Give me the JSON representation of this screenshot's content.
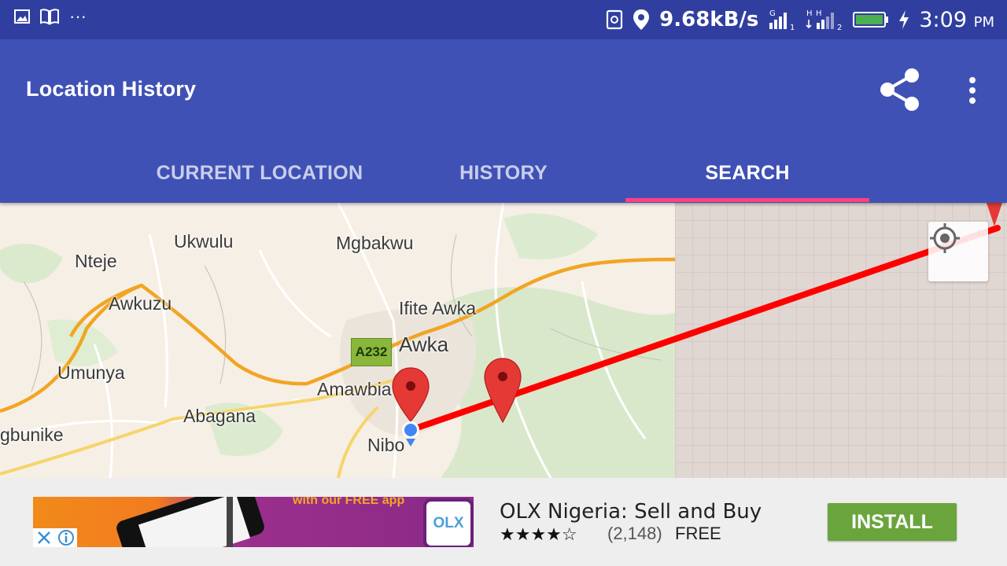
{
  "status_bar": {
    "speed": "9.68kB/s",
    "time": "3:09",
    "ampm": "PM",
    "sim1": "1",
    "sim2": "2",
    "net1": "G",
    "net2": "H"
  },
  "app_bar": {
    "title": "Location History",
    "tabs": [
      {
        "label": "CURRENT LOCATION",
        "active": false
      },
      {
        "label": "HISTORY",
        "active": false
      },
      {
        "label": "SEARCH",
        "active": true
      }
    ]
  },
  "map": {
    "places": [
      "Ukwulu",
      "Mgbakwu",
      "Nteje",
      "Awkuzu",
      "Ifite Awka",
      "Awka",
      "Umunya",
      "Amawbia",
      "Abagana",
      "gbunike",
      "Nibo"
    ],
    "route_shield": "A232",
    "route_color": "#ff0000",
    "marker_color": "#e53935",
    "current_location_color": "#4285f4"
  },
  "ad": {
    "promo_text": "with our FREE app",
    "logo_text": "OLX",
    "app_name": "OLX Nigeria: Sell and Buy",
    "rating": 4,
    "rating_out_of": 5,
    "reviews": "(2,148)",
    "price": "FREE",
    "install_label": "INSTALL"
  }
}
